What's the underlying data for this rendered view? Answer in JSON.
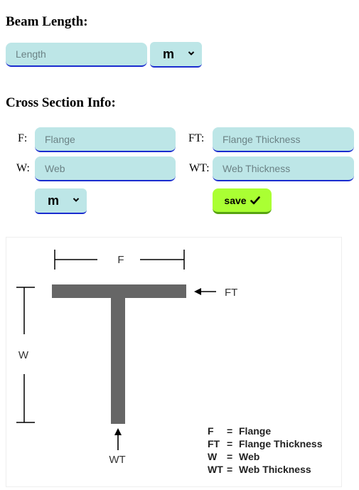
{
  "beam_length": {
    "heading": "Beam Length:",
    "length_placeholder": "Length",
    "unit": "m"
  },
  "cross_section": {
    "heading": "Cross Section Info:",
    "flange_label": "F:",
    "flange_placeholder": "Flange",
    "flange_thickness_label": "FT:",
    "flange_thickness_placeholder": "Flange Thickness",
    "web_label": "W:",
    "web_placeholder": "Web",
    "web_thickness_label": "WT:",
    "web_thickness_placeholder": "Web Thickness",
    "unit": "m",
    "save_label": "save"
  },
  "diagram": {
    "f_label": "F",
    "ft_label": "FT",
    "w_label": "W",
    "wt_label": "WT",
    "legend": [
      {
        "key": "F",
        "text": "Flange"
      },
      {
        "key": "FT",
        "text": "Flange Thickness"
      },
      {
        "key": "W",
        "text": "Web"
      },
      {
        "key": "WT",
        "text": "Web Thickness"
      }
    ]
  },
  "colors": {
    "input_bg": "#bde6e7",
    "input_border": "#1a2ccf",
    "save_bg": "#aaff33",
    "beam_gray": "#666666"
  },
  "icons": {
    "chevron": "chevron-down-icon",
    "check": "check-icon"
  }
}
